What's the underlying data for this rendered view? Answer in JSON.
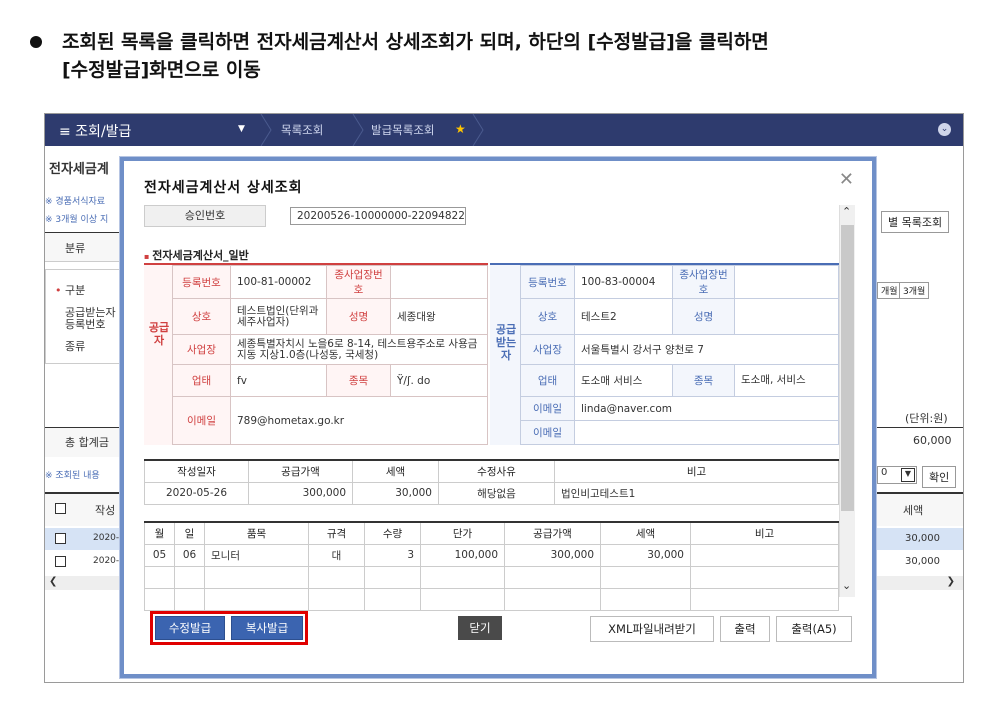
{
  "instruction": {
    "line1": "조회된 목록을 클릭하면 전자세금계산서 상세조회가 되며, 하단의 [수정발급]을 클릭하면",
    "line2": "[수정발급]화면으로 이동"
  },
  "topbar": {
    "menu": "≡  조회/발급",
    "crumb1": "목록조회",
    "crumb2": "발급목록조회"
  },
  "bg": {
    "page_title": "전자세금계",
    "note1": "※ 경품서식자료",
    "note2": "※ 3개월 이상 지",
    "row_bunryu": "분류",
    "row_gubun": "구분",
    "row_reg1": "공급받는자",
    "row_reg2": "등록번호",
    "row_type": "종류",
    "total": "총 합계금",
    "list_note": "※ 조회된 내용",
    "col_date": "작성",
    "r1": "2020-",
    "r2": "2020-",
    "btn_list": "별 목록조회",
    "btn_m1": "개월",
    "btn_m3": "3개월",
    "unit": "(단위:원)",
    "total_val": "60,000",
    "page_size": "0",
    "confirm": "확인",
    "col_tax": "세액",
    "tax1": "30,000",
    "tax2": "30,000"
  },
  "modal": {
    "title": "전자세금계산서 상세조회",
    "approval_label": "승인번호",
    "approval_value": "20200526-10000000-22094822",
    "section_title": "전자세금계산서_일반",
    "supplier": {
      "side": "공급자",
      "reg_label": "등록번호",
      "reg": "100-81-00002",
      "sub_label": "종사업장번호",
      "sub": "",
      "name_label": "상호",
      "name": "테스트법인(단위과세주사업자)",
      "rep_label": "성명",
      "rep": "세종대왕",
      "addr_label": "사업장",
      "addr": "세종특별자치시 노을6로 8-14, 테스트용주소로 사용금지동 지상1.0층(나성동, 국세청)",
      "biz_label": "업태",
      "biz": "fv",
      "item_label": "종목",
      "item": "Ϋ/ʃ. do",
      "email_label": "이메일",
      "email": "789@hometax.go.kr"
    },
    "buyer": {
      "side": "공급받는자",
      "reg_label": "등록번호",
      "reg": "100-83-00004",
      "sub_label": "종사업장번호",
      "sub": "",
      "name_label": "상호",
      "name": "테스트2",
      "rep_label": "성명",
      "rep": "",
      "addr_label": "사업장",
      "addr": "서울특별시 강서구 양천로 7",
      "biz_label": "업태",
      "biz": "도소매 서비스",
      "item_label": "종목",
      "item": "도소매, 서비스",
      "email_label": "이메일",
      "email1": "linda@naver.com",
      "email2": ""
    },
    "summary": {
      "headers": [
        "작성일자",
        "공급가액",
        "세액",
        "수정사유",
        "비고"
      ],
      "row": [
        "2020-05-26",
        "300,000",
        "30,000",
        "해당없음",
        "법인비고테스트1"
      ]
    },
    "items": {
      "headers": [
        "월",
        "일",
        "품목",
        "규격",
        "수량",
        "단가",
        "공급가액",
        "세액",
        "비고"
      ],
      "row": [
        "05",
        "06",
        "모니터",
        "대",
        "3",
        "100,000",
        "300,000",
        "30,000",
        ""
      ]
    },
    "buttons": {
      "modify": "수정발급",
      "copy": "복사발급",
      "close": "닫기",
      "xml": "XML파일내려받기",
      "print": "출력",
      "print_a5": "출력(A5)"
    },
    "highlight_color": "#e00000"
  }
}
